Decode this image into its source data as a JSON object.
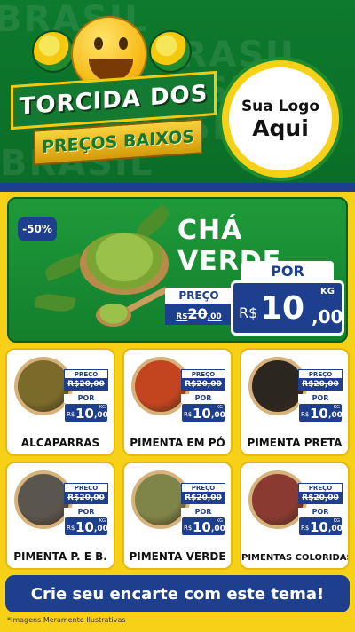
{
  "header": {
    "bg_word": "BRASIL",
    "title_line1": "TORCIDA DOS",
    "title_line2": "PREÇOS BAIXOS",
    "logo_line1": "Sua Logo",
    "logo_line2": "Aqui"
  },
  "hero": {
    "badge": "-50%",
    "title": "CHÁ VERDE",
    "old_label": "PREÇO",
    "old_price_cur": "R$",
    "old_price": "20",
    "old_price_dec": ",00",
    "por_label": "POR",
    "new_price_cur": "R$",
    "new_price_int": "10",
    "new_price_dec": ",00",
    "unit": "KG"
  },
  "products": [
    {
      "name": "ALCAPARRAS",
      "old_label": "PREÇO",
      "old_price": "R$20,00",
      "por": "POR",
      "cur": "R$",
      "int": "10",
      "dec": ",00",
      "unit": "KG",
      "color": "#7a6b2a"
    },
    {
      "name": "PIMENTA EM PÓ",
      "old_label": "PREÇO",
      "old_price": "R$20,00",
      "por": "POR",
      "cur": "R$",
      "int": "10",
      "dec": ",00",
      "unit": "KG",
      "color": "#c2451f"
    },
    {
      "name": "PIMENTA PRETA",
      "old_label": "PREÇO",
      "old_price": "R$20,00",
      "por": "POR",
      "cur": "R$",
      "int": "10",
      "dec": ",00",
      "unit": "KG",
      "color": "#2c2620"
    },
    {
      "name": "PIMENTA P. E B.",
      "old_label": "PREÇO",
      "old_price": "R$20,00",
      "por": "POR",
      "cur": "R$",
      "int": "10",
      "dec": ",00",
      "unit": "KG",
      "color": "#5a554e"
    },
    {
      "name": "PIMENTA VERDE",
      "old_label": "PREÇO",
      "old_price": "R$20,00",
      "por": "POR",
      "cur": "R$",
      "int": "10",
      "dec": ",00",
      "unit": "KG",
      "color": "#7f8448"
    },
    {
      "name": "PIMENTAS COLORIDAS",
      "old_label": "PREÇO",
      "old_price": "R$20,00",
      "por": "POR",
      "cur": "R$",
      "int": "10",
      "dec": ",00",
      "unit": "KG",
      "color": "#8b3a32"
    }
  ],
  "cta": "Crie seu encarte com este tema!",
  "disclaimer": "*Imagens Meramente Ilustrativas",
  "colors": {
    "green": "#0d7a2d",
    "yellow": "#f6d117",
    "blue": "#1d3f8e"
  }
}
